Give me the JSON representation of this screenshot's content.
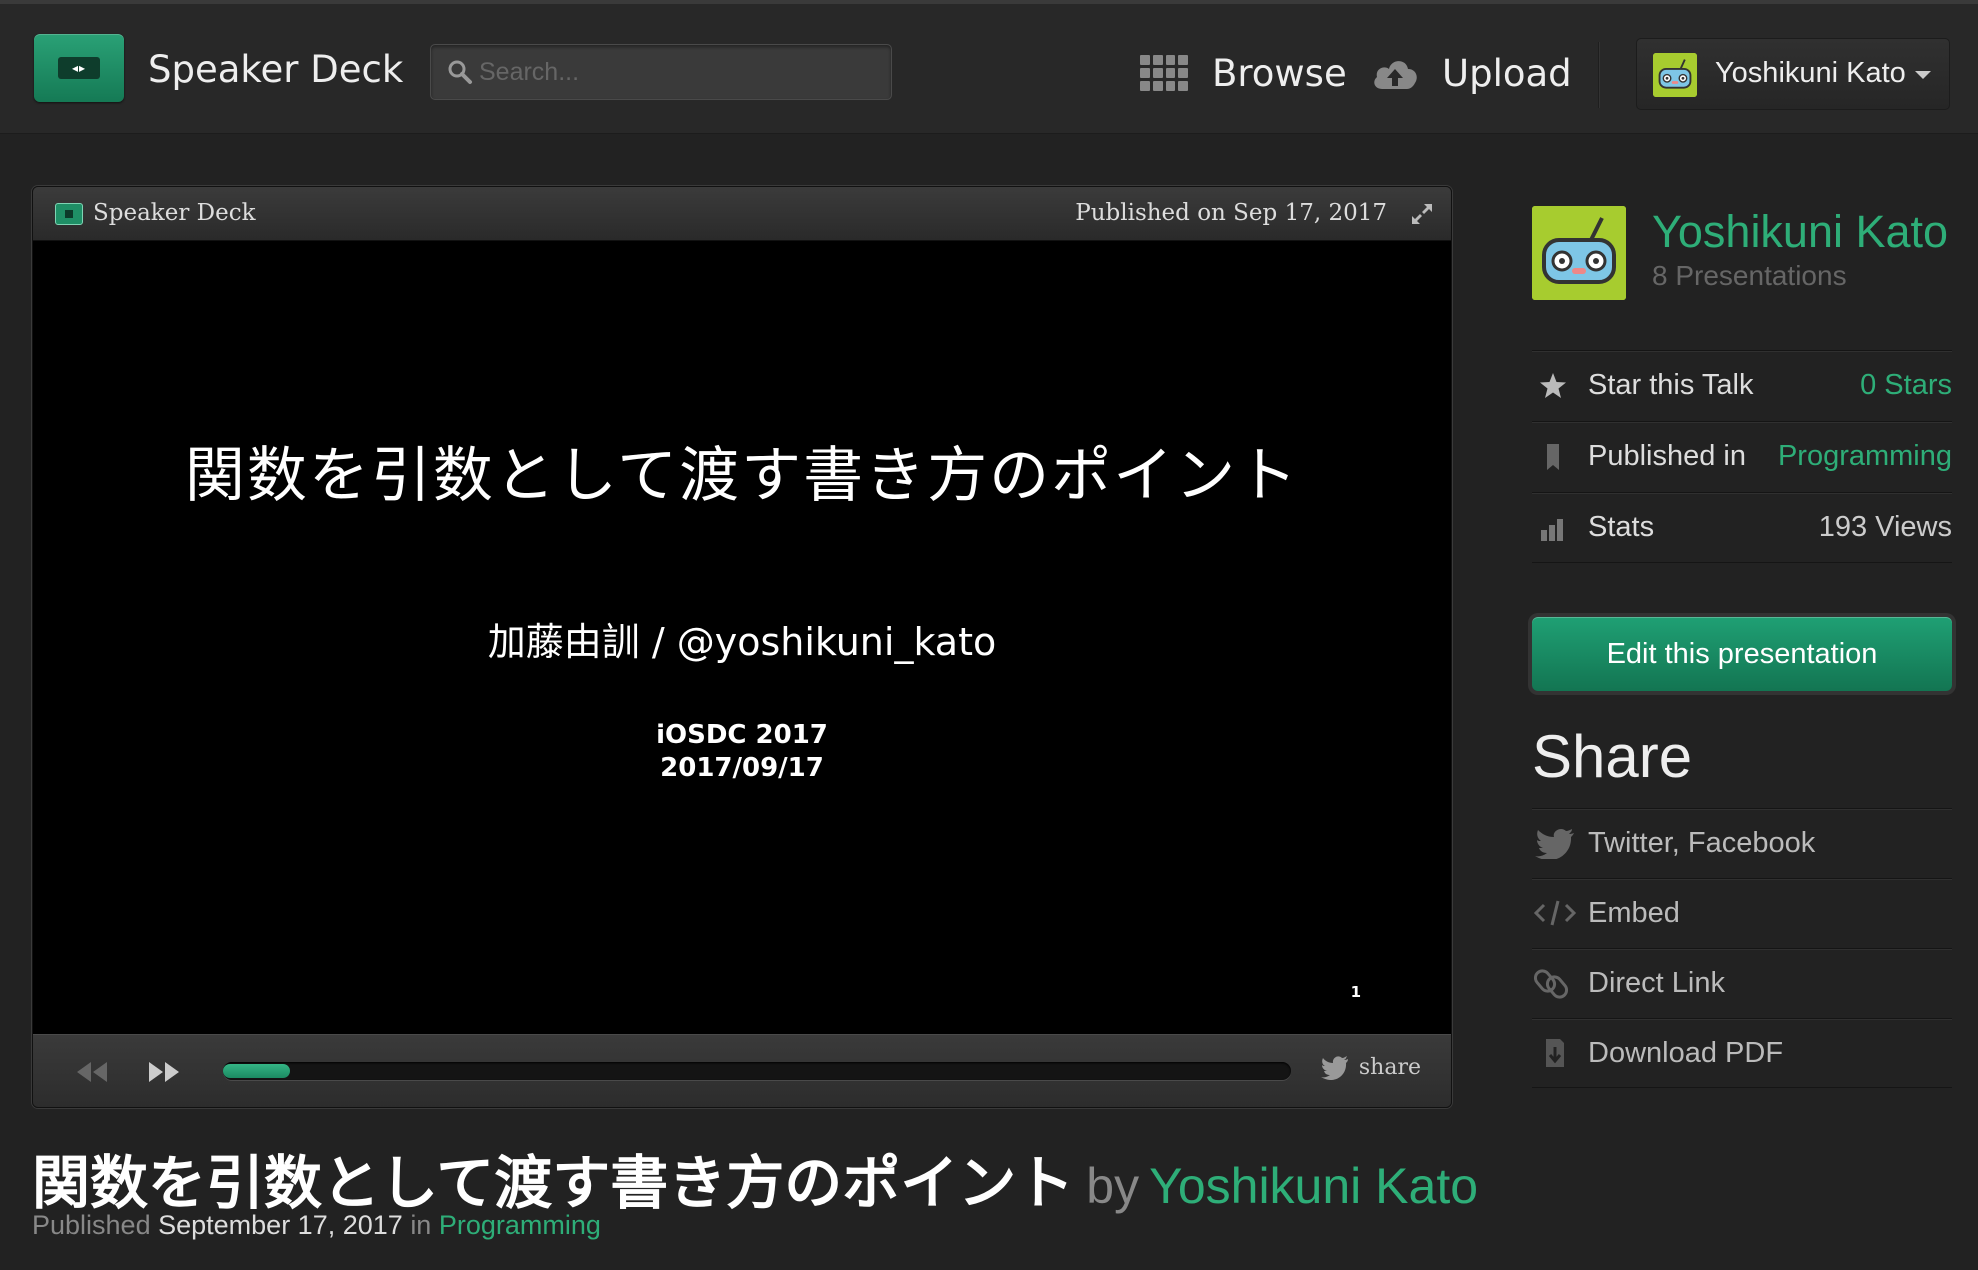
{
  "header": {
    "brand": "Speaker Deck",
    "search_placeholder": "Search...",
    "nav": {
      "browse": "Browse",
      "upload": "Upload"
    },
    "user": {
      "name": "Yoshikuni Kato"
    }
  },
  "player": {
    "brand": "Speaker Deck",
    "published": "Published on Sep 17, 2017",
    "slide": {
      "title": "関数を引数として渡す書き方のポイント",
      "author": "加藤由訓 / @yoshikuni_kato",
      "conference": "iOSDC 2017",
      "date": "2017/09/17",
      "page_number": "1"
    },
    "progress_percent": 6.3,
    "share_label": "share"
  },
  "talk": {
    "title": "関数を引数として渡す書き方のポイント",
    "by": "by",
    "author": "Yoshikuni Kato",
    "published_label": "Published",
    "published_date": "September 17, 2017",
    "in_label": "in",
    "category": "Programming"
  },
  "sidebar": {
    "author_name": "Yoshikuni Kato",
    "presentations": "8 Presentations",
    "rows": [
      {
        "label": "Star this Talk",
        "value": "0 Stars",
        "icon": "star-icon"
      },
      {
        "label": "Published in",
        "value": "Programming",
        "icon": "bookmark-icon"
      },
      {
        "label": "Stats",
        "value": "193 Views",
        "icon": "bar-chart-icon"
      }
    ],
    "edit_button": "Edit this presentation",
    "share_heading": "Share",
    "share_items": [
      {
        "label": "Twitter, Facebook",
        "icon": "twitter-bird-icon"
      },
      {
        "label": "Embed",
        "icon": "code-icon"
      },
      {
        "label": "Direct Link",
        "icon": "link-icon"
      },
      {
        "label": "Download PDF",
        "icon": "download-icon"
      }
    ]
  },
  "colors": {
    "accent": "#2eae78",
    "background": "#222222",
    "button": "#1a8e66"
  }
}
